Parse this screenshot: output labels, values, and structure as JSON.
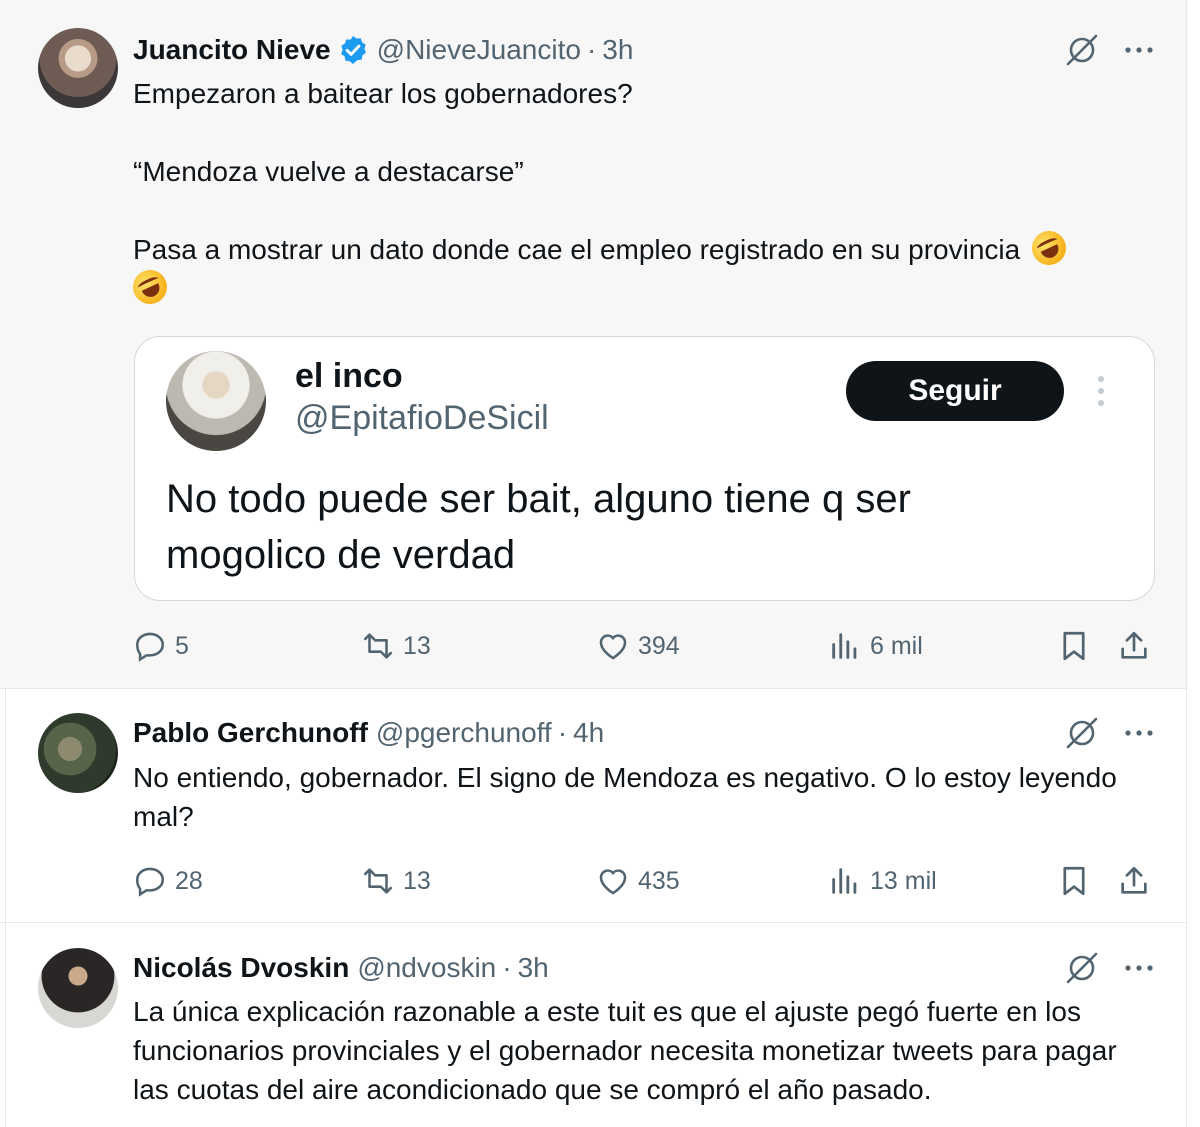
{
  "tweets": [
    {
      "name": "Juancito Nieve",
      "handle": "@NieveJuancito",
      "separator": "·",
      "time": "3h",
      "verified": true,
      "text": "Empezaron a baitear los gobernadores?\n\n“Mendoza vuelve a destacarse”\n\nPasa a mostrar un dato donde cae el empleo registrado en su provincia ",
      "emoji": [
        "rolling-on-floor-laughing",
        "rolling-on-floor-laughing"
      ],
      "quote": {
        "name": "el inco",
        "handle": "@EpitafioDeSicil",
        "follow_label": "Seguir",
        "text": "No todo puede ser bait, alguno tiene q ser mogolico de verdad"
      },
      "stats": {
        "replies": "5",
        "reposts": "13",
        "likes": "394",
        "views": "6 mil"
      }
    },
    {
      "name": "Pablo Gerchunoff",
      "handle": "@pgerchunoff",
      "separator": "·",
      "time": "4h",
      "text": "No entiendo, gobernador. El signo de Mendoza es negativo. O lo estoy leyendo mal?",
      "stats": {
        "replies": "28",
        "reposts": "13",
        "likes": "435",
        "views": "13 mil"
      }
    },
    {
      "name": "Nicolás Dvoskin",
      "handle": "@ndvoskin",
      "separator": "·",
      "time": "3h",
      "text": "La única explicación razonable a este tuit es que el ajuste pegó fuerte en los funcionarios provinciales y el gobernador necesita monetizar tweets para pagar las cuotas del aire acondicionado que se compró el año pasado."
    }
  ],
  "colors": {
    "text": "#0f1419",
    "secondary": "#536471",
    "verified": "#1d9bf0",
    "border": "#e6e9ea"
  }
}
